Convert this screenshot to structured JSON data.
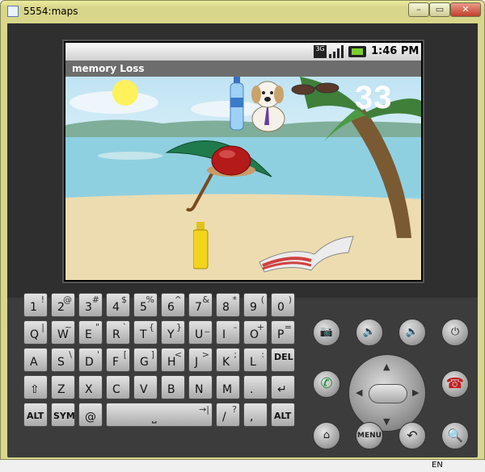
{
  "window": {
    "title": "5554:maps",
    "min_label": "–",
    "max_label": "▭",
    "close_label": "✕"
  },
  "statusbar": {
    "network": "3G",
    "time": "1:46 PM"
  },
  "app": {
    "title": "memory Loss",
    "score": "33"
  },
  "keyboard": {
    "row1": [
      {
        "main": "1",
        "alt": "!"
      },
      {
        "main": "2",
        "alt": "@"
      },
      {
        "main": "3",
        "alt": "#"
      },
      {
        "main": "4",
        "alt": "$"
      },
      {
        "main": "5",
        "alt": "%"
      },
      {
        "main": "6",
        "alt": "^"
      },
      {
        "main": "7",
        "alt": "&"
      },
      {
        "main": "8",
        "alt": "*"
      },
      {
        "main": "9",
        "alt": "("
      },
      {
        "main": "0",
        "alt": ")"
      }
    ],
    "row2": [
      {
        "main": "Q",
        "alt": "|"
      },
      {
        "main": "W",
        "alt": "~"
      },
      {
        "main": "E",
        "alt": "\""
      },
      {
        "main": "R",
        "alt": "`"
      },
      {
        "main": "T",
        "alt": "{"
      },
      {
        "main": "Y",
        "alt": "}"
      },
      {
        "main": "U",
        "alt": "_"
      },
      {
        "main": "I",
        "alt": "-"
      },
      {
        "main": "O",
        "alt": "+"
      },
      {
        "main": "P",
        "alt": "="
      }
    ],
    "row3": [
      {
        "main": "A",
        "alt": ""
      },
      {
        "main": "S",
        "alt": "\\"
      },
      {
        "main": "D",
        "alt": "'"
      },
      {
        "main": "F",
        "alt": "["
      },
      {
        "main": "G",
        "alt": "]"
      },
      {
        "main": "H",
        "alt": "<"
      },
      {
        "main": "J",
        "alt": ">"
      },
      {
        "main": "K",
        "alt": ";"
      },
      {
        "main": "L",
        "alt": ":"
      },
      {
        "main": "DEL",
        "alt": ""
      }
    ],
    "row4": [
      {
        "main": "⇧",
        "alt": ""
      },
      {
        "main": "Z",
        "alt": ""
      },
      {
        "main": "X",
        "alt": ""
      },
      {
        "main": "C",
        "alt": ""
      },
      {
        "main": "V",
        "alt": ""
      },
      {
        "main": "B",
        "alt": ""
      },
      {
        "main": "N",
        "alt": ""
      },
      {
        "main": "M",
        "alt": ""
      },
      {
        "main": ".",
        "alt": ""
      },
      {
        "main": "↵",
        "alt": ""
      }
    ],
    "row5": {
      "alt_left": "ALT",
      "sym": "SYM",
      "at": "@",
      "space_hint": "→|",
      "slash": "/",
      "slash_alt": "?",
      "comma": ",",
      "alt_right": "ALT"
    }
  },
  "controls": {
    "menu_label": "MENU",
    "icons": [
      "camera-icon",
      "volume-down-icon",
      "volume-up-icon",
      "power-icon",
      "call-icon",
      "end-call-icon",
      "home-icon",
      "back-icon",
      "search-icon"
    ]
  },
  "taskbar": {
    "language": "EN"
  }
}
